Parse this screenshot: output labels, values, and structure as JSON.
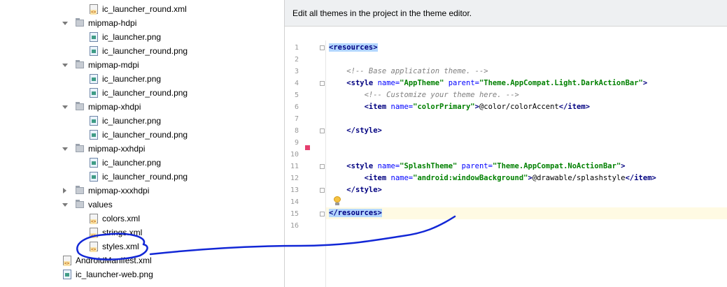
{
  "project_tree": {
    "items": [
      {
        "label": "ic_launcher_round.xml",
        "kind": "xml"
      },
      {
        "label": "mipmap-hdpi",
        "kind": "folder",
        "state": "expanded"
      },
      {
        "label": "ic_launcher.png",
        "kind": "png"
      },
      {
        "label": "ic_launcher_round.png",
        "kind": "png"
      },
      {
        "label": "mipmap-mdpi",
        "kind": "folder",
        "state": "expanded"
      },
      {
        "label": "ic_launcher.png",
        "kind": "png"
      },
      {
        "label": "ic_launcher_round.png",
        "kind": "png"
      },
      {
        "label": "mipmap-xhdpi",
        "kind": "folder",
        "state": "expanded"
      },
      {
        "label": "ic_launcher.png",
        "kind": "png"
      },
      {
        "label": "ic_launcher_round.png",
        "kind": "png"
      },
      {
        "label": "mipmap-xxhdpi",
        "kind": "folder",
        "state": "expanded"
      },
      {
        "label": "ic_launcher.png",
        "kind": "png"
      },
      {
        "label": "ic_launcher_round.png",
        "kind": "png"
      },
      {
        "label": "mipmap-xxxhdpi",
        "kind": "folder",
        "state": "collapsed"
      },
      {
        "label": "values",
        "kind": "folder",
        "state": "expanded"
      },
      {
        "label": "colors.xml",
        "kind": "xml"
      },
      {
        "label": "strings.xml",
        "kind": "xml"
      },
      {
        "label": "styles.xml",
        "kind": "xml"
      },
      {
        "label": "AndroidManifest.xml",
        "kind": "xml"
      },
      {
        "label": "ic_launcher-web.png",
        "kind": "png"
      }
    ]
  },
  "editor": {
    "banner": "Edit all themes in the project in the theme editor.",
    "line_numbers": [
      "1",
      "2",
      "3",
      "4",
      "5",
      "6",
      "7",
      "8",
      "9",
      "10",
      "11",
      "12",
      "13",
      "14",
      "15",
      "16"
    ],
    "code": {
      "l1_tag": "<resources>",
      "l3_comment": "<!-- Base application theme. -->",
      "l4_open": "<style ",
      "l4_a1": "name=",
      "l4_v1": "\"AppTheme\"",
      "l4_a2": " parent=",
      "l4_v2": "\"Theme.AppCompat.Light.DarkActionBar\"",
      "l4_close": ">",
      "l5_comment": "<!-- Customize your theme here. -->",
      "l6_open": "<item ",
      "l6_a1": "name=",
      "l6_v1": "\"colorPrimary\"",
      "l6_close": ">",
      "l6_text": "@color/colorAccent",
      "l6_end": "</item>",
      "l8_tag": "</style>",
      "l11_open": "<style ",
      "l11_a1": "name=",
      "l11_v1": "\"SplashTheme\"",
      "l11_a2": " parent=",
      "l11_v2": "\"Theme.AppCompat.NoActionBar\"",
      "l11_close": ">",
      "l12_open": "<item ",
      "l12_a1": "name=",
      "l12_v1": "\"android:windowBackground\"",
      "l12_close": ">",
      "l12_text": "@drawable/splashstyle",
      "l12_end": "</item>",
      "l13_tag": "</style>",
      "l15_tag": "</resources>"
    }
  },
  "colors": {
    "tag": "#000080",
    "attribute": "#0000ff",
    "value": "#008000",
    "comment": "#808080",
    "selection": "#b3d7ff",
    "current_line": "#fffae3",
    "bookmark": "#e53f6e",
    "annotation_ink": "#1227d6"
  },
  "icons": {
    "folder": "folder-icon",
    "png_file": "image-file-icon",
    "xml_file": "xml-file-icon",
    "bookmark": "bookmark-icon",
    "intention": "lightbulb-icon"
  }
}
